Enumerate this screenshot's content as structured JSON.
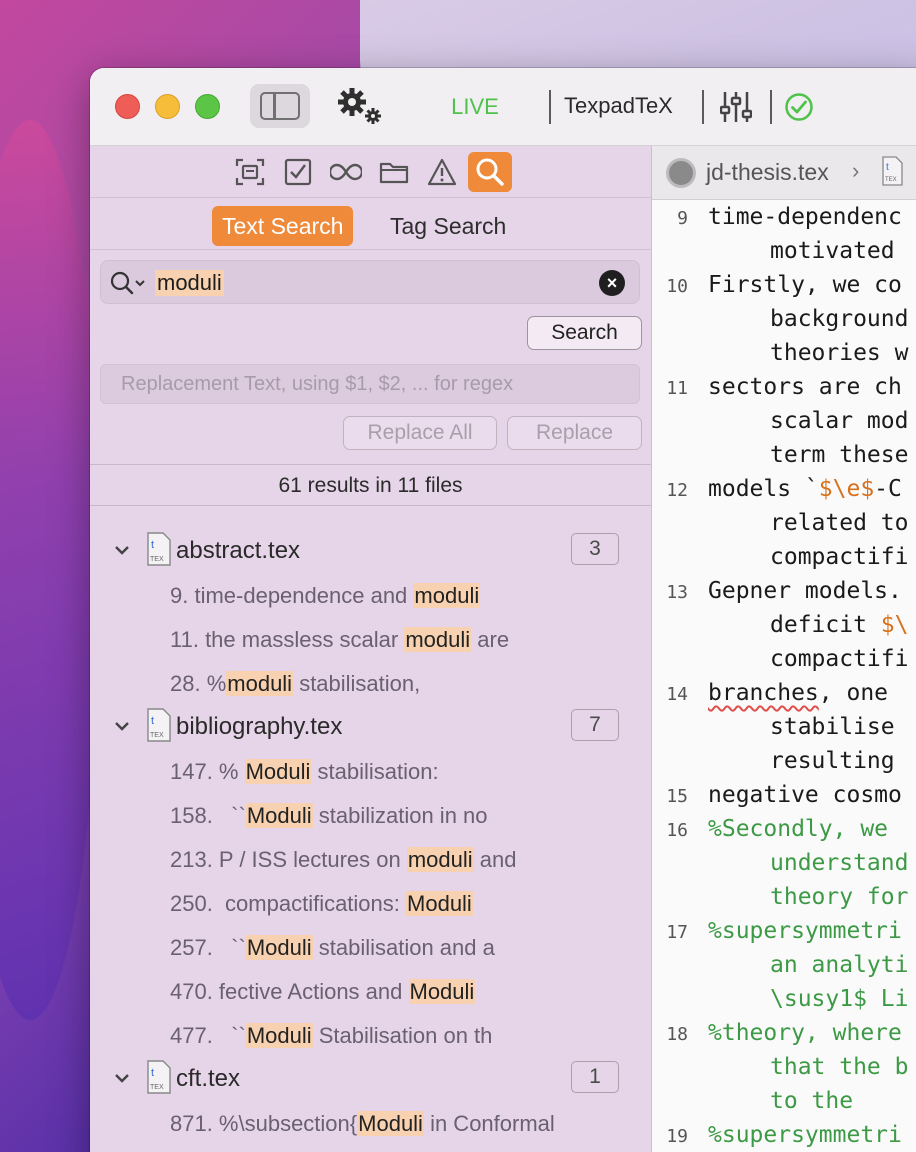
{
  "toolbar": {
    "live_label": "LIVE",
    "engine_label": "TexpadTeX"
  },
  "sidebar": {
    "tools": [
      "outline-icon",
      "todo-icon",
      "infinity-icon",
      "folder-icon",
      "warning-icon",
      "search-icon"
    ],
    "tabs": [
      {
        "label": "Text Search",
        "active": true
      },
      {
        "label": "Tag Search",
        "active": false
      }
    ],
    "search": {
      "query": "moduli",
      "button_label": "Search"
    },
    "replace": {
      "placeholder": "Replacement Text, using $1, $2, ... for regex",
      "replace_all_label": "Replace All",
      "replace_label": "Replace"
    },
    "results_summary": "61 results in 11 files",
    "files": [
      {
        "name": "abstract.tex",
        "count": "3",
        "matches": [
          {
            "before": "9. time-dependence and ",
            "hit": "moduli",
            "after": ""
          },
          {
            "before": "11. the massless scalar ",
            "hit": "moduli",
            "after": " are"
          },
          {
            "before": "28. %",
            "hit": "moduli",
            "after": " stabilisation,"
          }
        ]
      },
      {
        "name": "bibliography.tex",
        "count": "7",
        "matches": [
          {
            "before": "147. % ",
            "hit": "Moduli",
            "after": " stabilisation:"
          },
          {
            "before": "158.   ``",
            "hit": "Moduli",
            "after": " stabilization in no"
          },
          {
            "before": "213. P / ISS lectures on ",
            "hit": "moduli",
            "after": " and"
          },
          {
            "before": "250.  compactifications: ",
            "hit": "Moduli",
            "after": ""
          },
          {
            "before": "257.   ``",
            "hit": "Moduli",
            "after": " stabilisation and a"
          },
          {
            "before": "470. fective Actions and ",
            "hit": "Moduli",
            "after": ""
          },
          {
            "before": "477.   ``",
            "hit": "Moduli",
            "after": " Stabilisation on th"
          }
        ]
      },
      {
        "name": "cft.tex",
        "count": "1",
        "matches": [
          {
            "before": "871. %\\subsection{",
            "hit": "Moduli",
            "after": " in Conformal"
          }
        ]
      }
    ]
  },
  "editor": {
    "filename": "jd-thesis.tex",
    "breadcrumb_sep": "›",
    "lines": [
      {
        "n": "9",
        "rows": [
          "time-dependenc",
          "motivated"
        ]
      },
      {
        "n": "10",
        "rows": [
          "Firstly, we co",
          "background",
          "theories w"
        ]
      },
      {
        "n": "11",
        "rows": [
          "sectors are ch",
          "scalar mod",
          "term these"
        ]
      },
      {
        "n": "12",
        "rows": [
          "models `$\\e$-C",
          "related to",
          "compactifi"
        ]
      },
      {
        "n": "13",
        "rows": [
          "Gepner models.",
          "deficit $\\",
          "compactifi"
        ]
      },
      {
        "n": "14",
        "rows": [
          "branches, one",
          "stabilise",
          "resulting"
        ]
      },
      {
        "n": "15",
        "rows": [
          "negative cosmo"
        ]
      },
      {
        "n": "16",
        "rows": [
          "%Secondly, we",
          "understand",
          "theory for"
        ]
      },
      {
        "n": "17",
        "rows": [
          "%supersymmetri",
          "an analyti",
          "\\susy1$ Li"
        ]
      },
      {
        "n": "18",
        "rows": [
          "%theory, where",
          "that the b",
          "to the"
        ]
      },
      {
        "n": "19",
        "rows": [
          "%supersymmetri"
        ]
      }
    ]
  },
  "colors": {
    "accent": "#ee8a3a",
    "live": "#4fc24a",
    "highlight": "#f8d2b0",
    "math": "#d8711b",
    "comment": "#3c9a45"
  }
}
